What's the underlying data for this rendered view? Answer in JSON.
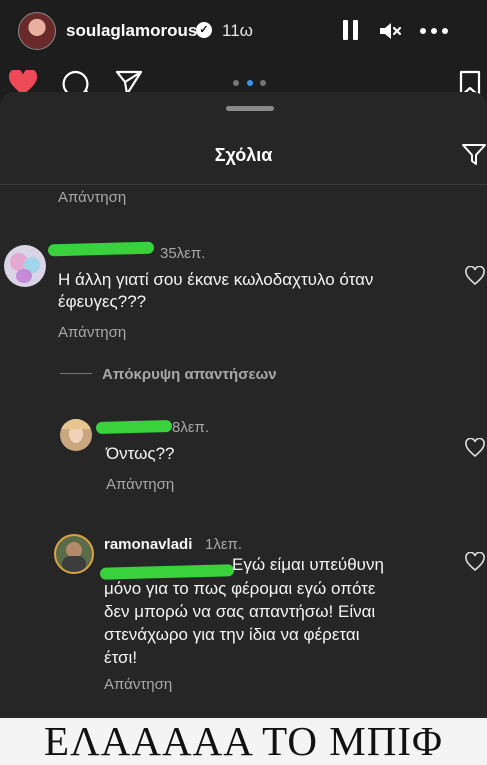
{
  "story": {
    "username": "soulaglamorous",
    "time": "11ω"
  },
  "sheet": {
    "title": "Σχόλια"
  },
  "reply_label": "Απάντηση",
  "comments": [
    {
      "meta": "35λεπ.",
      "text_line1": "Η άλλη γιατί σου έκανε κωλοδαχτυλο όταν",
      "text_line2": "έφευγες???"
    }
  ],
  "hide_replies": "Απόκρυψη απαντήσεων",
  "replies": [
    {
      "meta": "8λεπ.",
      "text": "Όντως??"
    },
    {
      "username": "ramonavladi",
      "meta": "1λεπ.",
      "lines": [
        "Εγώ είμαι υπεύθυνη",
        "μόνο για το πως φέρομαι εγώ οπότε",
        "δεν μπορώ να σας απαντήσω! Είναι",
        "στενάχωρο για την ίδια να φέρεται",
        "έτσι!"
      ]
    }
  ],
  "banner": "ΕΛΑΑΑΑΑ ΤΟ ΜΠΙΦ"
}
